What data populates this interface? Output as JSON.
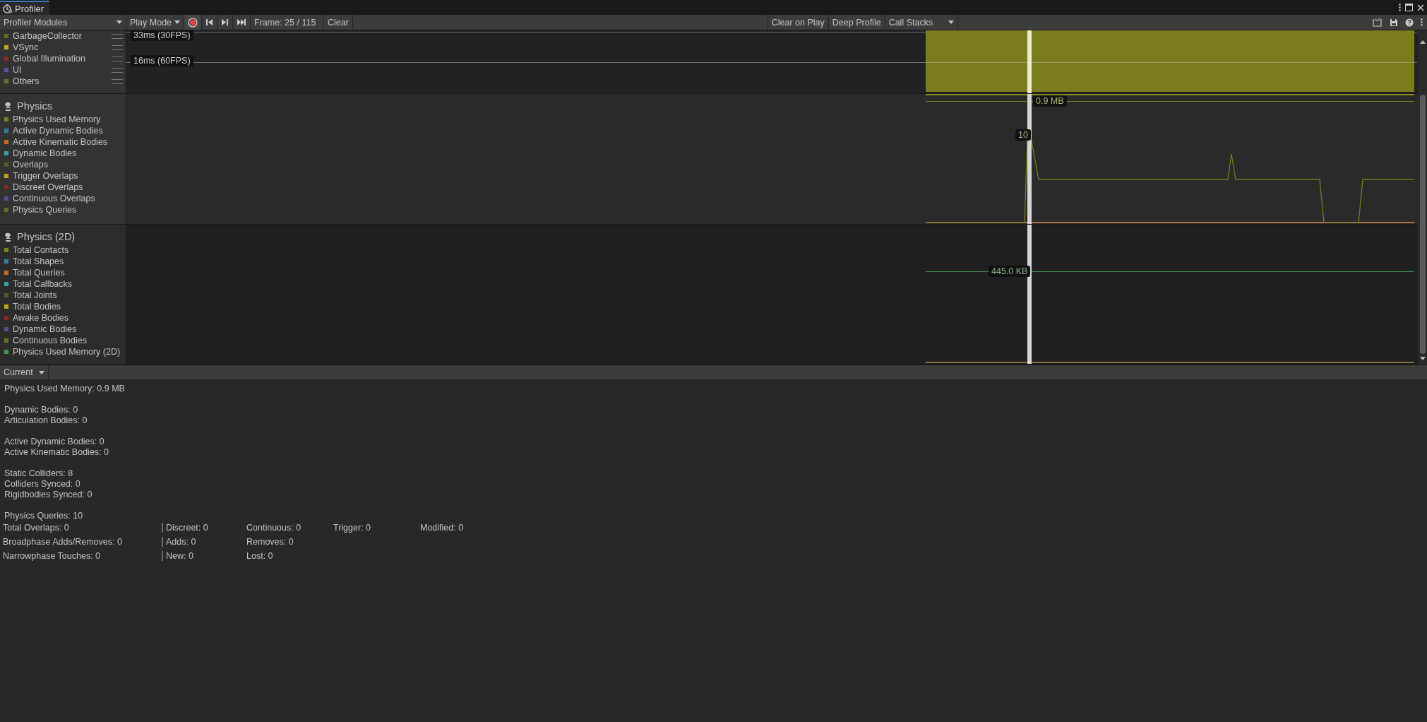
{
  "window": {
    "tab_title": "Profiler"
  },
  "toolbar": {
    "modules_dropdown": "Profiler Modules",
    "play_mode": "Play Mode",
    "record": {
      "on": true
    },
    "frame": "Frame: 25 / 115",
    "clear": "Clear",
    "clear_on_play": "Clear on Play",
    "deep_profile": "Deep Profile",
    "call_stacks": "Call Stacks"
  },
  "top_module": {
    "items": [
      {
        "label": "GarbageCollector",
        "color": "#6b6b1e"
      },
      {
        "label": "VSync",
        "color": "#c8a51a"
      },
      {
        "label": "Global Illumination",
        "color": "#8b2a16"
      },
      {
        "label": "UI",
        "color": "#6a4c9c"
      },
      {
        "label": "Others",
        "color": "#6e7320"
      }
    ],
    "markers": [
      "33ms (30FPS)",
      "16ms (60FPS)"
    ]
  },
  "physics": {
    "title": "Physics",
    "items": [
      {
        "label": "Physics Used Memory",
        "color": "#6d8c1e"
      },
      {
        "label": "Active Dynamic Bodies",
        "color": "#2f7fa0"
      },
      {
        "label": "Active Kinematic Bodies",
        "color": "#c7671a"
      },
      {
        "label": "Dynamic Bodies",
        "color": "#3a9cab"
      },
      {
        "label": "Overlaps",
        "color": "#5c5a1c"
      },
      {
        "label": "Trigger Overlaps",
        "color": "#c0a219"
      },
      {
        "label": "Discreet Overlaps",
        "color": "#8a2a17"
      },
      {
        "label": "Continuous Overlaps",
        "color": "#5a4a95"
      },
      {
        "label": "Physics Queries",
        "color": "#6e6e20"
      }
    ],
    "value_labels": [
      "0.9 MB",
      "10"
    ]
  },
  "physics_2d": {
    "title": "Physics (2D)",
    "items": [
      {
        "label": "Total Contacts",
        "color": "#6d8c1f"
      },
      {
        "label": "Total Shapes",
        "color": "#2f7fa1"
      },
      {
        "label": "Total Queries",
        "color": "#c7671b"
      },
      {
        "label": "Total Callbacks",
        "color": "#3a9cac"
      },
      {
        "label": "Total Joints",
        "color": "#5c5a1d"
      },
      {
        "label": "Total Bodies",
        "color": "#c0a21a"
      },
      {
        "label": "Awake Bodies",
        "color": "#8a2a18"
      },
      {
        "label": "Dynamic Bodies",
        "color": "#5a4a96"
      },
      {
        "label": "Continuous Bodies",
        "color": "#6e6e21"
      },
      {
        "label": "Physics Used Memory (2D)",
        "color": "#3c9a4e"
      }
    ],
    "value_labels": [
      "445.0 KB"
    ]
  },
  "details": {
    "view": "Current",
    "groups": [
      [
        "Physics Used Memory: 0.9 MB"
      ],
      [
        "Dynamic Bodies: 0",
        "Articulation Bodies: 0"
      ],
      [
        "Active Dynamic Bodies: 0",
        "Active Kinematic Bodies: 0"
      ],
      [
        "Static Colliders: 8",
        "Colliders Synced: 0",
        "Rigidbodies Synced: 0"
      ],
      [
        "Physics Queries: 10"
      ]
    ],
    "table": [
      [
        "Total Overlaps: 0",
        "Discreet: 0",
        "Continuous: 0",
        "Trigger: 0",
        "Modified: 0"
      ],
      [
        "Broadphase Adds/Removes: 0",
        "Adds: 0",
        "Removes: 0"
      ],
      [
        "Narrowphase Touches: 0",
        "New: 0",
        "Lost: 0"
      ]
    ]
  }
}
